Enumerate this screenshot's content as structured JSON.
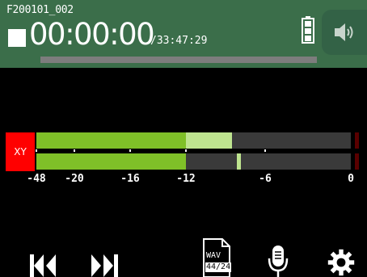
{
  "header": {
    "file_name": "F200101_002",
    "counter": "00:00:00",
    "remaining_time": "/33:47:29",
    "progress": 0,
    "battery": "full",
    "speaker_icon": "speaker-icon"
  },
  "meter": {
    "channel_label": "XY",
    "channels": [
      {
        "level_db": -12,
        "peak_db": -8.5
      },
      {
        "level_db": -12,
        "hold_db": -8
      }
    ],
    "scale_labels": [
      "-48",
      "-20",
      "-16",
      "-12",
      "-6",
      "0"
    ],
    "colors": {
      "level": "#7fc028",
      "peak": "#bee48f",
      "channel": "#ff0000"
    }
  },
  "toolbar": {
    "file_format_top": "WAV",
    "file_format_bottom": "44/24",
    "icons": [
      "previous-icon",
      "next-icon",
      "file-format-icon",
      "microphone-icon",
      "gear-icon"
    ]
  }
}
